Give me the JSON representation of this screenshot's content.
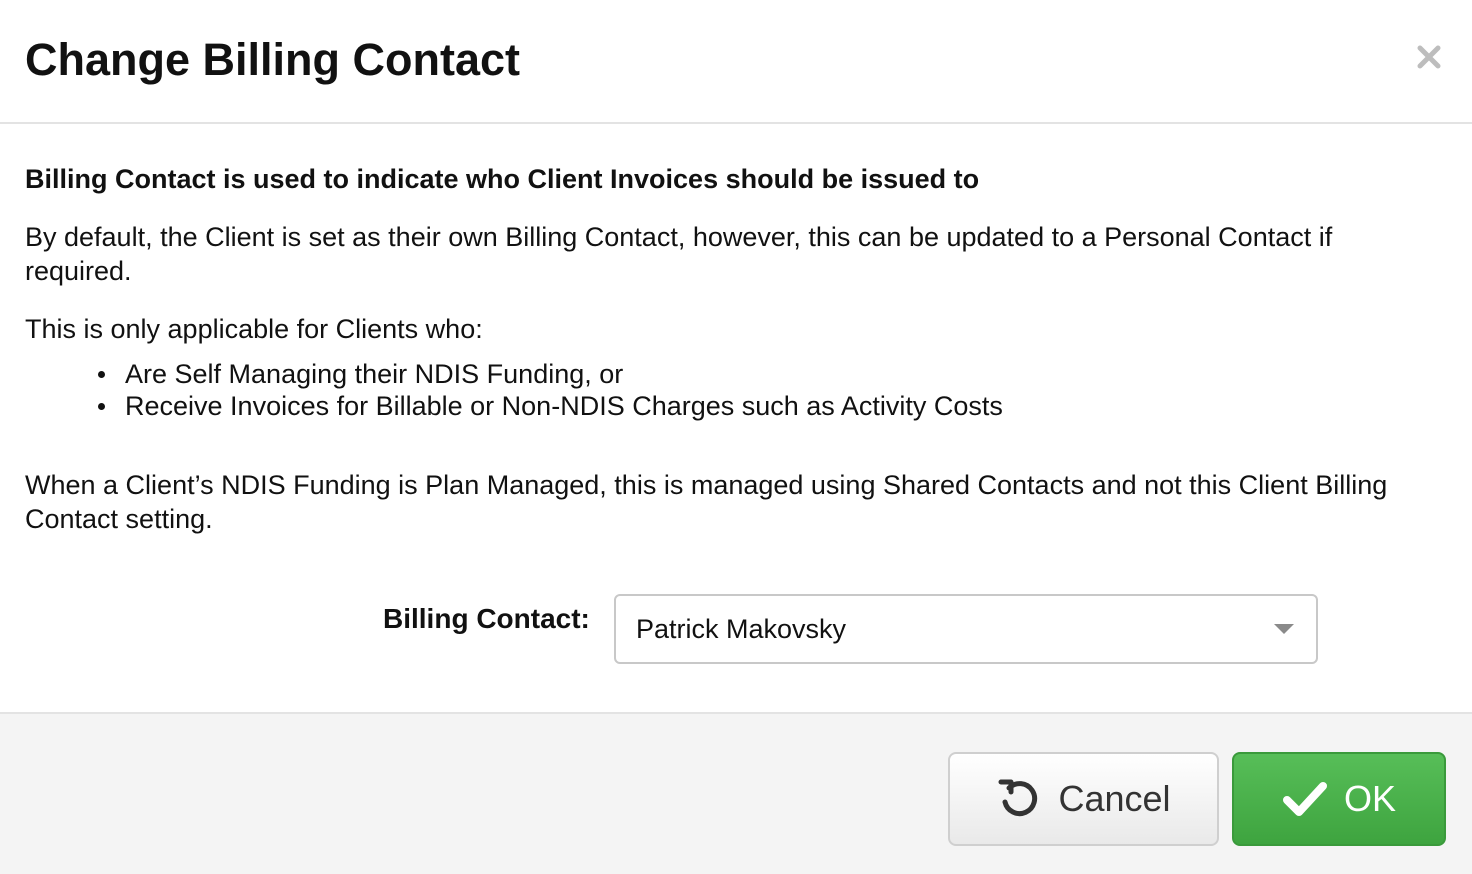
{
  "dialog": {
    "title": "Change Billing Contact",
    "close_icon": "close-icon"
  },
  "body": {
    "heading": "Billing Contact is used to indicate who Client Invoices should be issued to",
    "paragraph1": "By default, the Client is set as their own Billing Contact, however, this can be updated to a Personal Contact if required.",
    "paragraph2": "This is only applicable for Clients who:",
    "bullets": [
      "Are Self Managing their NDIS Funding, or",
      "Receive Invoices for Billable or Non-NDIS Charges such as Activity Costs"
    ],
    "paragraph3": "When a Client’s NDIS Funding is Plan Managed, this is managed using Shared Contacts and not this Client Billing Contact setting."
  },
  "form": {
    "billing_contact_label": "Billing Contact:",
    "billing_contact_value": "Patrick Makovsky"
  },
  "footer": {
    "cancel_label": "Cancel",
    "cancel_icon": "undo-icon",
    "ok_label": "OK",
    "ok_icon": "check-icon"
  },
  "colors": {
    "ok_button": "#4cae4c",
    "footer_bg": "#f4f4f4",
    "border": "#e3e3e3"
  }
}
